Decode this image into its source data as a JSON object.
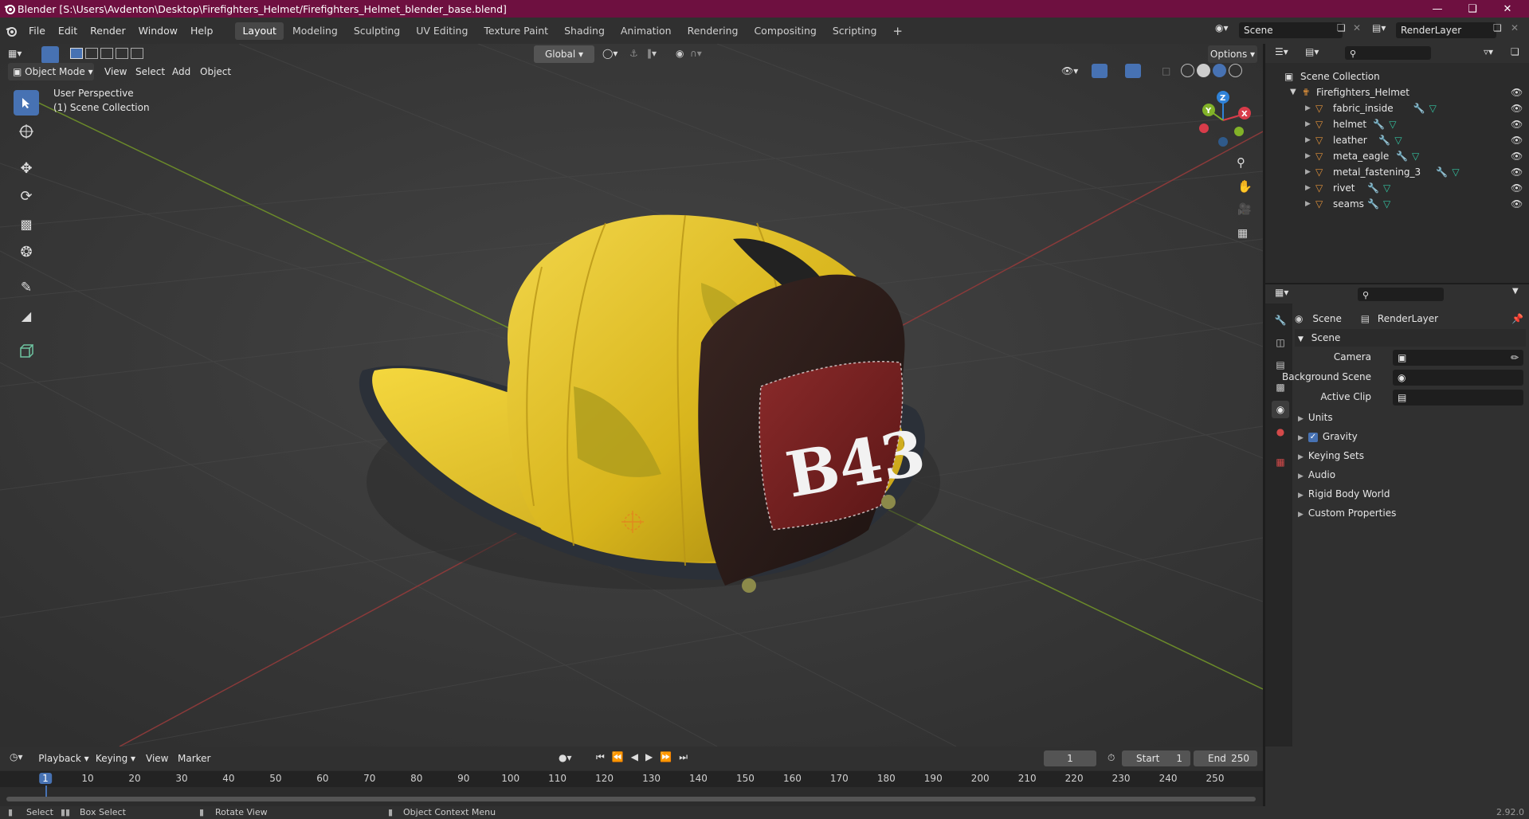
{
  "window": {
    "title": "Blender [S:\\Users\\Avdenton\\Desktop\\Firefighters_Helmet/Firefighters_Helmet_blender_base.blend]"
  },
  "menus": [
    "File",
    "Edit",
    "Render",
    "Window",
    "Help"
  ],
  "workspaces": [
    "Layout",
    "Modeling",
    "Sculpting",
    "UV Editing",
    "Texture Paint",
    "Shading",
    "Animation",
    "Rendering",
    "Compositing",
    "Scripting"
  ],
  "active_workspace": "Layout",
  "scene_selector": {
    "value": "Scene"
  },
  "layer_selector": {
    "value": "RenderLayer"
  },
  "viewport": {
    "mode": "Object Mode",
    "menus": [
      "View",
      "Select",
      "Add",
      "Object"
    ],
    "orientation": "Global",
    "options_label": "Options",
    "overlay_line1": "User Perspective",
    "overlay_line2": "(1) Scene Collection",
    "badge_text": "B43",
    "gizmo_axes": [
      "Z",
      "Y",
      "X"
    ]
  },
  "outliner": {
    "root": "Scene Collection",
    "collection": "Firefighters_Helmet",
    "objects": [
      "fabric_inside",
      "helmet",
      "leather",
      "meta_eagle",
      "metal_fastening_3",
      "rivet",
      "seams"
    ]
  },
  "properties": {
    "crumb_scene": "Scene",
    "crumb_layer": "RenderLayer",
    "panel_title": "Scene",
    "camera_label": "Camera",
    "background_label": "Background Scene",
    "clip_label": "Active Clip",
    "sections": [
      "Units",
      "Gravity",
      "Keying Sets",
      "Audio",
      "Rigid Body World",
      "Custom Properties"
    ],
    "gravity_checked": true
  },
  "timeline": {
    "menus": [
      "Playback",
      "Keying",
      "View",
      "Marker"
    ],
    "current_frame": "1",
    "start_label": "Start",
    "start_value": "1",
    "end_label": "End",
    "end_value": "250",
    "ticks": [
      "1",
      "10",
      "20",
      "30",
      "40",
      "50",
      "60",
      "70",
      "80",
      "90",
      "100",
      "110",
      "120",
      "130",
      "140",
      "150",
      "160",
      "170",
      "180",
      "190",
      "200",
      "210",
      "220",
      "230",
      "240",
      "250"
    ]
  },
  "status": {
    "select": "Select",
    "box_select": "Box Select",
    "rotate": "Rotate View",
    "context": "Object Context Menu",
    "version": "2.92.0"
  }
}
